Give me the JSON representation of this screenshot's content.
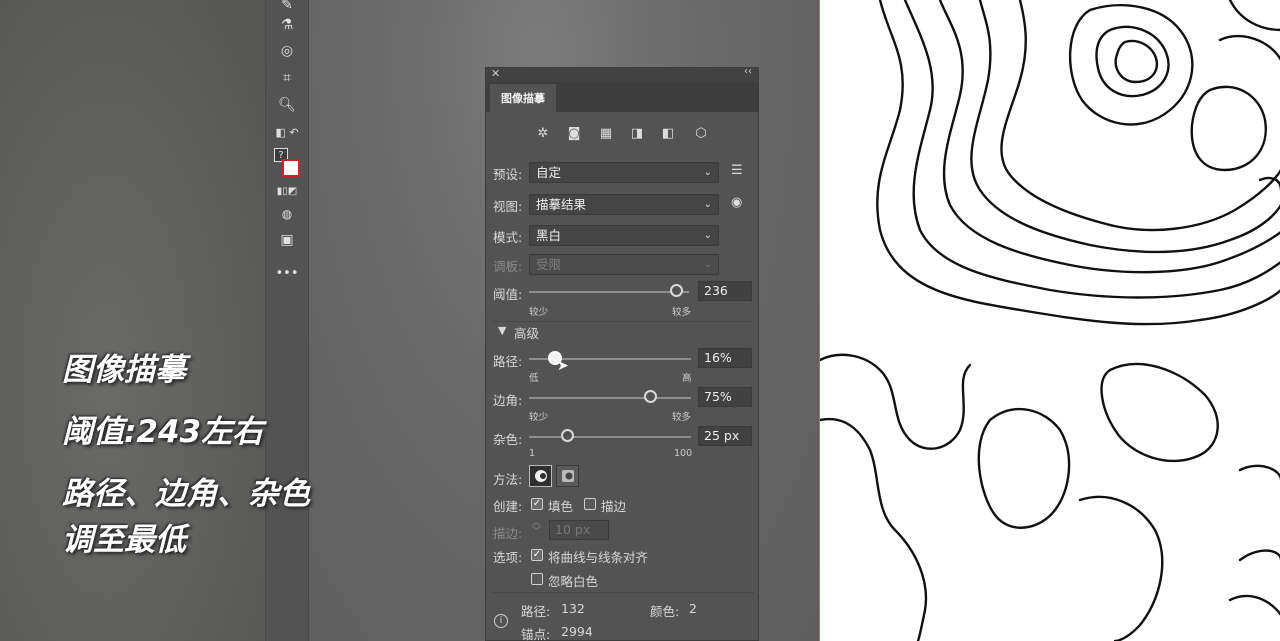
{
  "caption": {
    "line1": "图像描摹",
    "line2": "阈值:243左右",
    "line3": "路径、边角、杂色",
    "line4": "调至最低"
  },
  "panel": {
    "tab_title": "图像描摹",
    "preset_label": "预设:",
    "preset_value": "自定",
    "view_label": "视图:",
    "view_value": "描摹结果",
    "mode_label": "模式:",
    "mode_value": "黑白",
    "palette_label": "调板:",
    "palette_value": "受限",
    "threshold_label": "阈值:",
    "threshold_value": "236",
    "threshold_level": 236,
    "threshold_min_label": "较少",
    "threshold_max_label": "较多",
    "advanced_label": "高级",
    "paths_label": "路径:",
    "paths_value": "16%",
    "paths_level": 0.16,
    "paths_min_label": "低",
    "paths_max_label": "高",
    "corners_label": "边角:",
    "corners_value": "75%",
    "corners_level": 0.75,
    "corners_min_label": "较少",
    "corners_max_label": "较多",
    "noise_label": "杂色:",
    "noise_value": "25 px",
    "noise_level": 25,
    "noise_min_label": "1",
    "noise_max_label": "100",
    "method_label": "方法:",
    "create_label": "创建:",
    "fill_label": "填色",
    "fill_checked": true,
    "stroke_label": "描边",
    "stroke_checked": false,
    "stroke_width_label": "描边:",
    "stroke_width_value": "10 px",
    "options_label": "选项:",
    "snap_label": "将曲线与线条对齐",
    "snap_checked": true,
    "ignore_white_label": "忽略白色",
    "ignore_white_checked": false,
    "stat_paths_label": "路径:",
    "stat_paths_value": "132",
    "stat_colors_label": "颜色:",
    "stat_colors_value": "2",
    "stat_anchors_label": "锚点:",
    "stat_anchors_value": "2994"
  },
  "icons": {
    "panel_close": "close-icon",
    "panel_collapse": "collapse-icon",
    "preset_menu": "list-icon",
    "view_toggle": "eye-icon",
    "info": "info-icon"
  },
  "colors": {
    "panel_bg": "#535353",
    "artboard_bg": "#ffffff",
    "contour_stroke": "#111111",
    "artboard_edge": "#d06060"
  }
}
